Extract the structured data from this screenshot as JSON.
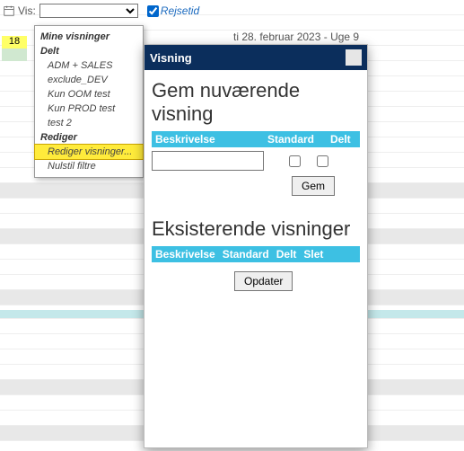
{
  "topbar": {
    "vis_label": "Vis:",
    "rejsetid_label": "Rejsetid"
  },
  "date_header": "ti 28. februar 2023 - Uge 9",
  "calendar": {
    "day18": "18"
  },
  "dropdown": {
    "group_mine": "Mine visninger",
    "group_delt": "Delt",
    "items_delt": {
      "a": "ADM + SALES",
      "b": "exclude_DEV",
      "c": "Kun OOM test",
      "d": "Kun PROD test",
      "e": "test 2"
    },
    "group_rediger": "Rediger",
    "item_rediger": "Rediger visninger...",
    "item_nulstil": "Nulstil filtre"
  },
  "panel": {
    "title": "Visning",
    "h_save": "Gem nuværende visning",
    "col_besk": "Beskrivelse",
    "col_standard": "Standard",
    "col_delt": "Delt",
    "btn_gem": "Gem",
    "h_exist": "Eksisterende visninger",
    "col_besk2": "Beskrivelse",
    "col_standard2": "Standard",
    "col_delt2": "Delt",
    "col_slet": "Slet",
    "btn_opdater": "Opdater"
  }
}
